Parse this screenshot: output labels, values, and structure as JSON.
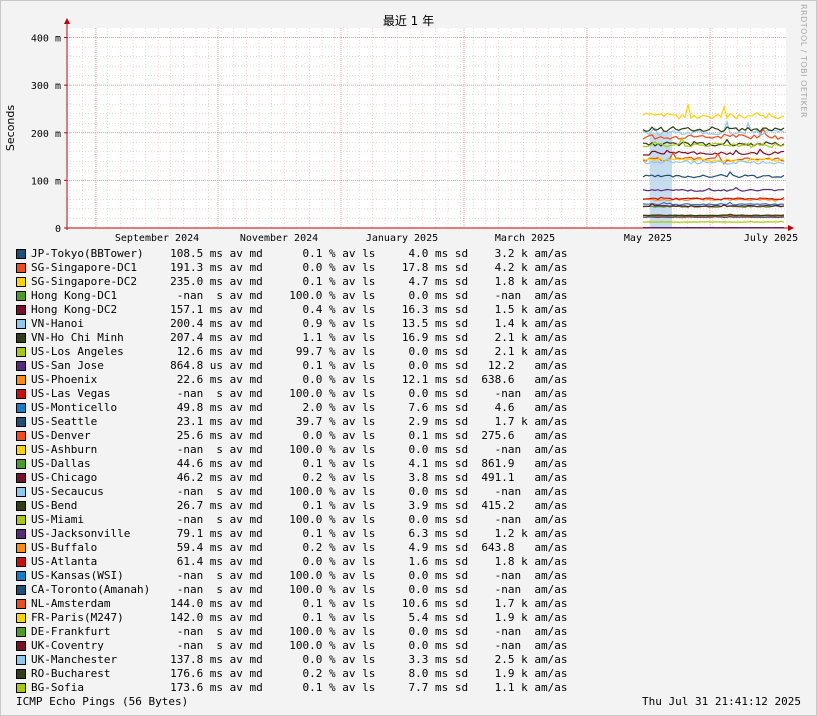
{
  "chart_data": {
    "type": "line",
    "title": "最近 1 年",
    "ylabel": "Seconds",
    "xlabel": "",
    "ylim": [
      0,
      0.42
    ],
    "yticks": [
      {
        "value": 0,
        "label": "0"
      },
      {
        "value": 0.1,
        "label": "100 m"
      },
      {
        "value": 0.2,
        "label": "200 m"
      },
      {
        "value": 0.3,
        "label": "300 m"
      },
      {
        "value": 0.4,
        "label": "400 m"
      }
    ],
    "xticks": [
      "September 2024",
      "November 2024",
      "January 2025",
      "March 2025",
      "May 2025",
      "July 2025"
    ],
    "grid": true,
    "series": [
      {
        "name": "JP-Tokyo(BBTower)",
        "color": "#1f4e79",
        "avg": "108.5 ms",
        "loss": "0.1 %",
        "sd": "4.0 ms",
        "amas": "3.2 k",
        "value": 0.1085
      },
      {
        "name": "SG-Singapore-DC1",
        "color": "#f04b1c",
        "avg": "191.3 ms",
        "loss": "0.0 %",
        "sd": "17.8 ms",
        "amas": "4.2 k",
        "value": 0.1913
      },
      {
        "name": "SG-Singapore-DC2",
        "color": "#ffd200",
        "avg": "235.0 ms",
        "loss": "0.1 %",
        "sd": "4.7 ms",
        "amas": "1.8 k",
        "value": 0.235
      },
      {
        "name": "Hong Kong-DC1",
        "color": "#4e9a28",
        "avg": "-nan  s",
        "loss": "100.0 %",
        "sd": "0.0 ms",
        "amas": "-nan ",
        "value": null
      },
      {
        "name": "Hong Kong-DC2",
        "color": "#7a0f28",
        "avg": "157.1 ms",
        "loss": "0.4 %",
        "sd": "16.3 ms",
        "amas": "1.5 k",
        "value": 0.1571
      },
      {
        "name": "VN-Hanoi",
        "color": "#8ec7f0",
        "avg": "200.4 ms",
        "loss": "0.9 %",
        "sd": "13.5 ms",
        "amas": "1.4 k",
        "value": 0.2004
      },
      {
        "name": "VN-Ho Chi Minh",
        "color": "#2f3f10",
        "avg": "207.4 ms",
        "loss": "1.1 %",
        "sd": "16.9 ms",
        "amas": "2.1 k",
        "value": 0.2074
      },
      {
        "name": "US-Los Angeles",
        "color": "#a8c810",
        "avg": "12.6 ms",
        "loss": "99.7 %",
        "sd": "0.0 ms",
        "amas": "2.1 k",
        "value": 0.0126
      },
      {
        "name": "US-San Jose",
        "color": "#5a2a7a",
        "avg": "864.8 us",
        "loss": "0.1 %",
        "sd": "0.0 ms",
        "amas": "12.2  ",
        "value": 0.0008648
      },
      {
        "name": "US-Phoenix",
        "color": "#ff8a10",
        "avg": "22.6 ms",
        "loss": "0.0 %",
        "sd": "12.1 ms",
        "amas": "638.6  ",
        "value": 0.0226
      },
      {
        "name": "US-Las Vegas",
        "color": "#c81010",
        "avg": "-nan  s",
        "loss": "100.0 %",
        "sd": "0.0 ms",
        "amas": "-nan ",
        "value": null
      },
      {
        "name": "US-Monticello",
        "color": "#1a7ac8",
        "avg": "49.8 ms",
        "loss": "2.0 %",
        "sd": "7.6 ms",
        "amas": "4.6  ",
        "value": 0.0498
      },
      {
        "name": "US-Seattle",
        "color": "#1f4e79",
        "avg": "23.1 ms",
        "loss": "39.7 %",
        "sd": "2.9 ms",
        "amas": "1.7 k",
        "value": 0.0231
      },
      {
        "name": "US-Denver",
        "color": "#f04b1c",
        "avg": "25.6 ms",
        "loss": "0.0 %",
        "sd": "0.1 ms",
        "amas": "275.6  ",
        "value": 0.0256
      },
      {
        "name": "US-Ashburn",
        "color": "#ffd200",
        "avg": "-nan  s",
        "loss": "100.0 %",
        "sd": "0.0 ms",
        "amas": "-nan ",
        "value": null
      },
      {
        "name": "US-Dallas",
        "color": "#4e9a28",
        "avg": "44.6 ms",
        "loss": "0.1 %",
        "sd": "4.1 ms",
        "amas": "861.9  ",
        "value": 0.0446
      },
      {
        "name": "US-Chicago",
        "color": "#7a0f28",
        "avg": "46.2 ms",
        "loss": "0.2 %",
        "sd": "3.8 ms",
        "amas": "491.1  ",
        "value": 0.0462
      },
      {
        "name": "US-Secaucus",
        "color": "#8ec7f0",
        "avg": "-nan  s",
        "loss": "100.0 %",
        "sd": "0.0 ms",
        "amas": "-nan ",
        "value": null
      },
      {
        "name": "US-Bend",
        "color": "#2f3f10",
        "avg": "26.7 ms",
        "loss": "0.1 %",
        "sd": "3.9 ms",
        "amas": "415.2  ",
        "value": 0.0267
      },
      {
        "name": "US-Miami",
        "color": "#a8c810",
        "avg": "-nan  s",
        "loss": "100.0 %",
        "sd": "0.0 ms",
        "amas": "-nan ",
        "value": null
      },
      {
        "name": "US-Jacksonville",
        "color": "#5a2a7a",
        "avg": "79.1 ms",
        "loss": "0.1 %",
        "sd": "6.3 ms",
        "amas": "1.2 k",
        "value": 0.0791
      },
      {
        "name": "US-Buffalo",
        "color": "#ff8a10",
        "avg": "59.4 ms",
        "loss": "0.2 %",
        "sd": "4.9 ms",
        "amas": "643.8  ",
        "value": 0.0594
      },
      {
        "name": "US-Atlanta",
        "color": "#c81010",
        "avg": "61.4 ms",
        "loss": "0.0 %",
        "sd": "1.6 ms",
        "amas": "1.8 k",
        "value": 0.0614
      },
      {
        "name": "US-Kansas(WSI)",
        "color": "#1a7ac8",
        "avg": "-nan  s",
        "loss": "100.0 %",
        "sd": "0.0 ms",
        "amas": "-nan ",
        "value": null
      },
      {
        "name": "CA-Toronto(Amanah)",
        "color": "#1f4e79",
        "avg": "-nan  s",
        "loss": "100.0 %",
        "sd": "0.0 ms",
        "amas": "-nan ",
        "value": null
      },
      {
        "name": "NL-Amsterdam",
        "color": "#f04b1c",
        "avg": "144.0 ms",
        "loss": "0.1 %",
        "sd": "10.6 ms",
        "amas": "1.7 k",
        "value": 0.144
      },
      {
        "name": "FR-Paris(M247)",
        "color": "#ffd200",
        "avg": "142.0 ms",
        "loss": "0.1 %",
        "sd": "5.4 ms",
        "amas": "1.9 k",
        "value": 0.142
      },
      {
        "name": "DE-Frankfurt",
        "color": "#4e9a28",
        "avg": "-nan  s",
        "loss": "100.0 %",
        "sd": "0.0 ms",
        "amas": "-nan ",
        "value": null
      },
      {
        "name": "UK-Coventry",
        "color": "#7a0f28",
        "avg": "-nan  s",
        "loss": "100.0 %",
        "sd": "0.0 ms",
        "amas": "-nan ",
        "value": null
      },
      {
        "name": "UK-Manchester",
        "color": "#8ec7f0",
        "avg": "137.8 ms",
        "loss": "0.0 %",
        "sd": "3.3 ms",
        "amas": "2.5 k",
        "value": 0.1378
      },
      {
        "name": "RO-Bucharest",
        "color": "#2f3f10",
        "avg": "176.6 ms",
        "loss": "0.2 %",
        "sd": "8.0 ms",
        "amas": "1.9 k",
        "value": 0.1766
      },
      {
        "name": "BG-Sofia",
        "color": "#a8c810",
        "avg": "173.6 ms",
        "loss": "0.1 %",
        "sd": "7.7 ms",
        "amas": "1.1 k",
        "value": 0.1736
      }
    ]
  },
  "legend_suffixes": {
    "avg": "av md",
    "loss": "av ls",
    "sd": "sd",
    "amas": "am/as"
  },
  "footer": {
    "left": "ICMP Echo Pings (56 Bytes)",
    "right": "Thu Jul 31 21:41:12 2025"
  },
  "watermark": "RRDTOOL / TOBI OETIKER",
  "colors": {
    "grid_minor": "#e6b0b0",
    "grid_major": "#d09090",
    "axis": "#c00000",
    "canvas": "#ffffff",
    "loss_band": "#b8d4ec"
  }
}
